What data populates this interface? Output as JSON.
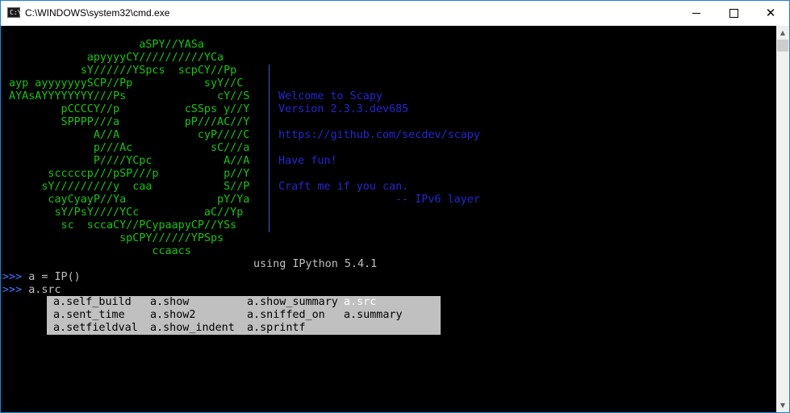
{
  "window": {
    "title": "C:\\WINDOWS\\system32\\cmd.exe",
    "icon": "cmd-icon",
    "icon_text": "C:\\"
  },
  "controls": {
    "minimize_icon": "minimize-icon",
    "maximize_icon": "maximize-icon",
    "close_icon": "close-icon",
    "close_glyph": "✕"
  },
  "banner": {
    "art": [
      "                     aSPY//YASa",
      "             apyyyyCY//////////YCa",
      "            sY//////YSpcs  scpCY//Pp",
      " ayp ayyyyyyySCP//Pp           syY//C",
      " AYAsAYYYYYYYY///Ps              cY//S",
      "         pCCCCY//p          cSSps y//Y",
      "         SPPPP///a          pP///AC//Y",
      "              A//A            cyP////C",
      "              p///Ac            sC///a",
      "              P////YCpc           A//A",
      "       scccccp///pSP///p          p//Y",
      "      sY/////////y  caa           S//P",
      "       cayCyayP//Ya              pY/Ya",
      "        sY/PsY////YCc          aC//Yp",
      "         sc  sccaCY//PCypaapyCP//YSs",
      "                  spCPY//////YPSps",
      "                       ccaacs"
    ],
    "info": [
      "",
      "",
      "Welcome to Scapy",
      "Version 2.3.3.dev685",
      "",
      "https://github.com/secdev/scapy",
      "",
      "Have fun!",
      "",
      "Craft me if you can.",
      "                  -- IPv6 layer",
      "",
      ""
    ],
    "ipython_line": "using IPython 5.4.1"
  },
  "session": {
    "prompt": ">>>",
    "lines": [
      {
        "prompt": ">>>",
        "code": " a = IP()"
      },
      {
        "prompt": ">>>",
        "code": " a.src"
      }
    ]
  },
  "completion": {
    "items": [
      {
        "label": "a.self_build",
        "row": 0,
        "col": 0,
        "selected": false
      },
      {
        "label": "a.show",
        "row": 0,
        "col": 1,
        "selected": false
      },
      {
        "label": "a.show_summary",
        "row": 0,
        "col": 2,
        "selected": false
      },
      {
        "label": "a.src",
        "row": 0,
        "col": 3,
        "selected": true
      },
      {
        "label": "a.sent_time",
        "row": 1,
        "col": 0,
        "selected": false
      },
      {
        "label": "a.show2",
        "row": 1,
        "col": 1,
        "selected": false
      },
      {
        "label": "a.sniffed_on",
        "row": 1,
        "col": 2,
        "selected": false
      },
      {
        "label": "a.summary",
        "row": 1,
        "col": 3,
        "selected": false
      },
      {
        "label": "a.setfieldval",
        "row": 2,
        "col": 0,
        "selected": false
      },
      {
        "label": "a.show_indent",
        "row": 2,
        "col": 1,
        "selected": false
      },
      {
        "label": "a.sprintf",
        "row": 2,
        "col": 2,
        "selected": false
      }
    ]
  },
  "scrollbar": {
    "up_icon": "scroll-up-arrow-icon",
    "down_icon": "scroll-down-arrow-icon",
    "up_glyph": "▲",
    "down_glyph": "▼"
  },
  "colors": {
    "terminal_bg": "#000000",
    "art": "#16c60c",
    "info": "#2525d4",
    "prompt": "#3b78ff",
    "completion_bg": "#c0c0c0",
    "accent_border": "#1883d7"
  }
}
